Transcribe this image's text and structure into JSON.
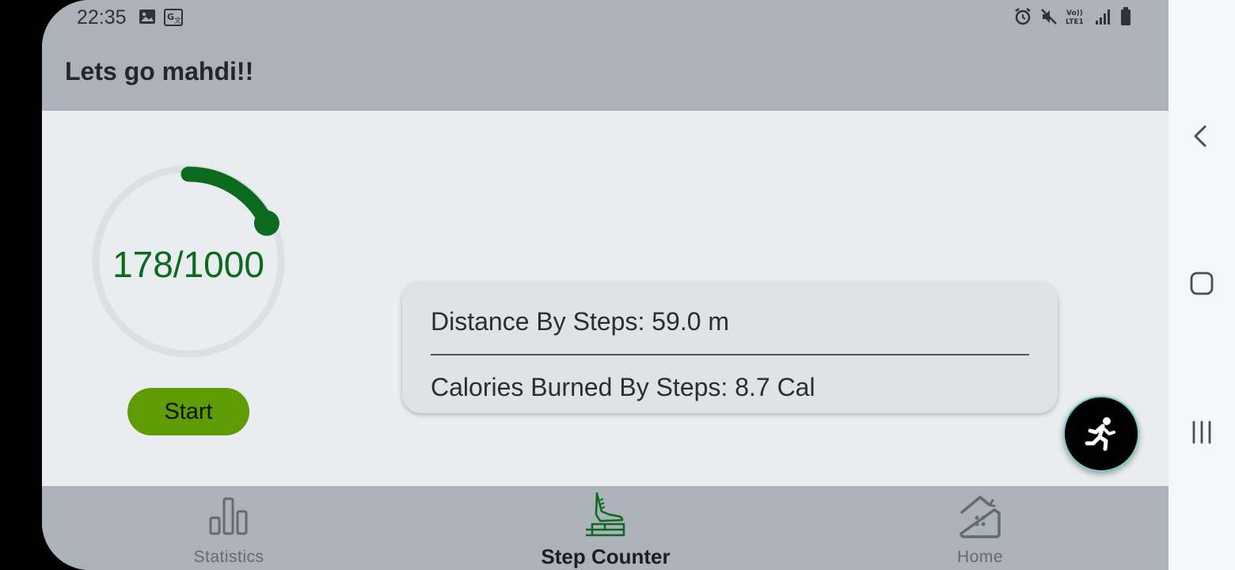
{
  "status_bar": {
    "time": "22:35",
    "left_icons": [
      "image-icon",
      "translate-icon"
    ],
    "right_icons": [
      "alarm-icon",
      "mute-icon",
      "volte-icon",
      "signal-icon",
      "battery-icon"
    ],
    "volte_text": "Vo)) LTE1"
  },
  "app_bar": {
    "title": "Lets go mahdi!!"
  },
  "progress": {
    "current": 178,
    "goal": 1000,
    "text": "178/1000",
    "fraction": 0.178,
    "color": "#0b6a1e",
    "track_color": "#dde0e3"
  },
  "start_button": {
    "label": "Start"
  },
  "info_card": {
    "distance": "Distance By Steps: 59.0 m",
    "calories": "Calories Burned By Steps: 8.7 Cal"
  },
  "fab": {
    "icon": "running-person-icon"
  },
  "bottom_nav": {
    "items": [
      {
        "label": "Statistics",
        "icon": "bar-chart-icon",
        "active": false
      },
      {
        "label": "Step Counter",
        "icon": "shoe-step-icon",
        "active": true
      },
      {
        "label": "Home",
        "icon": "home-icon",
        "active": false
      }
    ]
  },
  "system_nav": [
    "back-icon",
    "home-square-icon",
    "recents-icon"
  ],
  "colors": {
    "accent": "#0b6a1e",
    "start_button": "#5e9b04",
    "bars": "#abb2ba",
    "background": "#eaedf0"
  }
}
